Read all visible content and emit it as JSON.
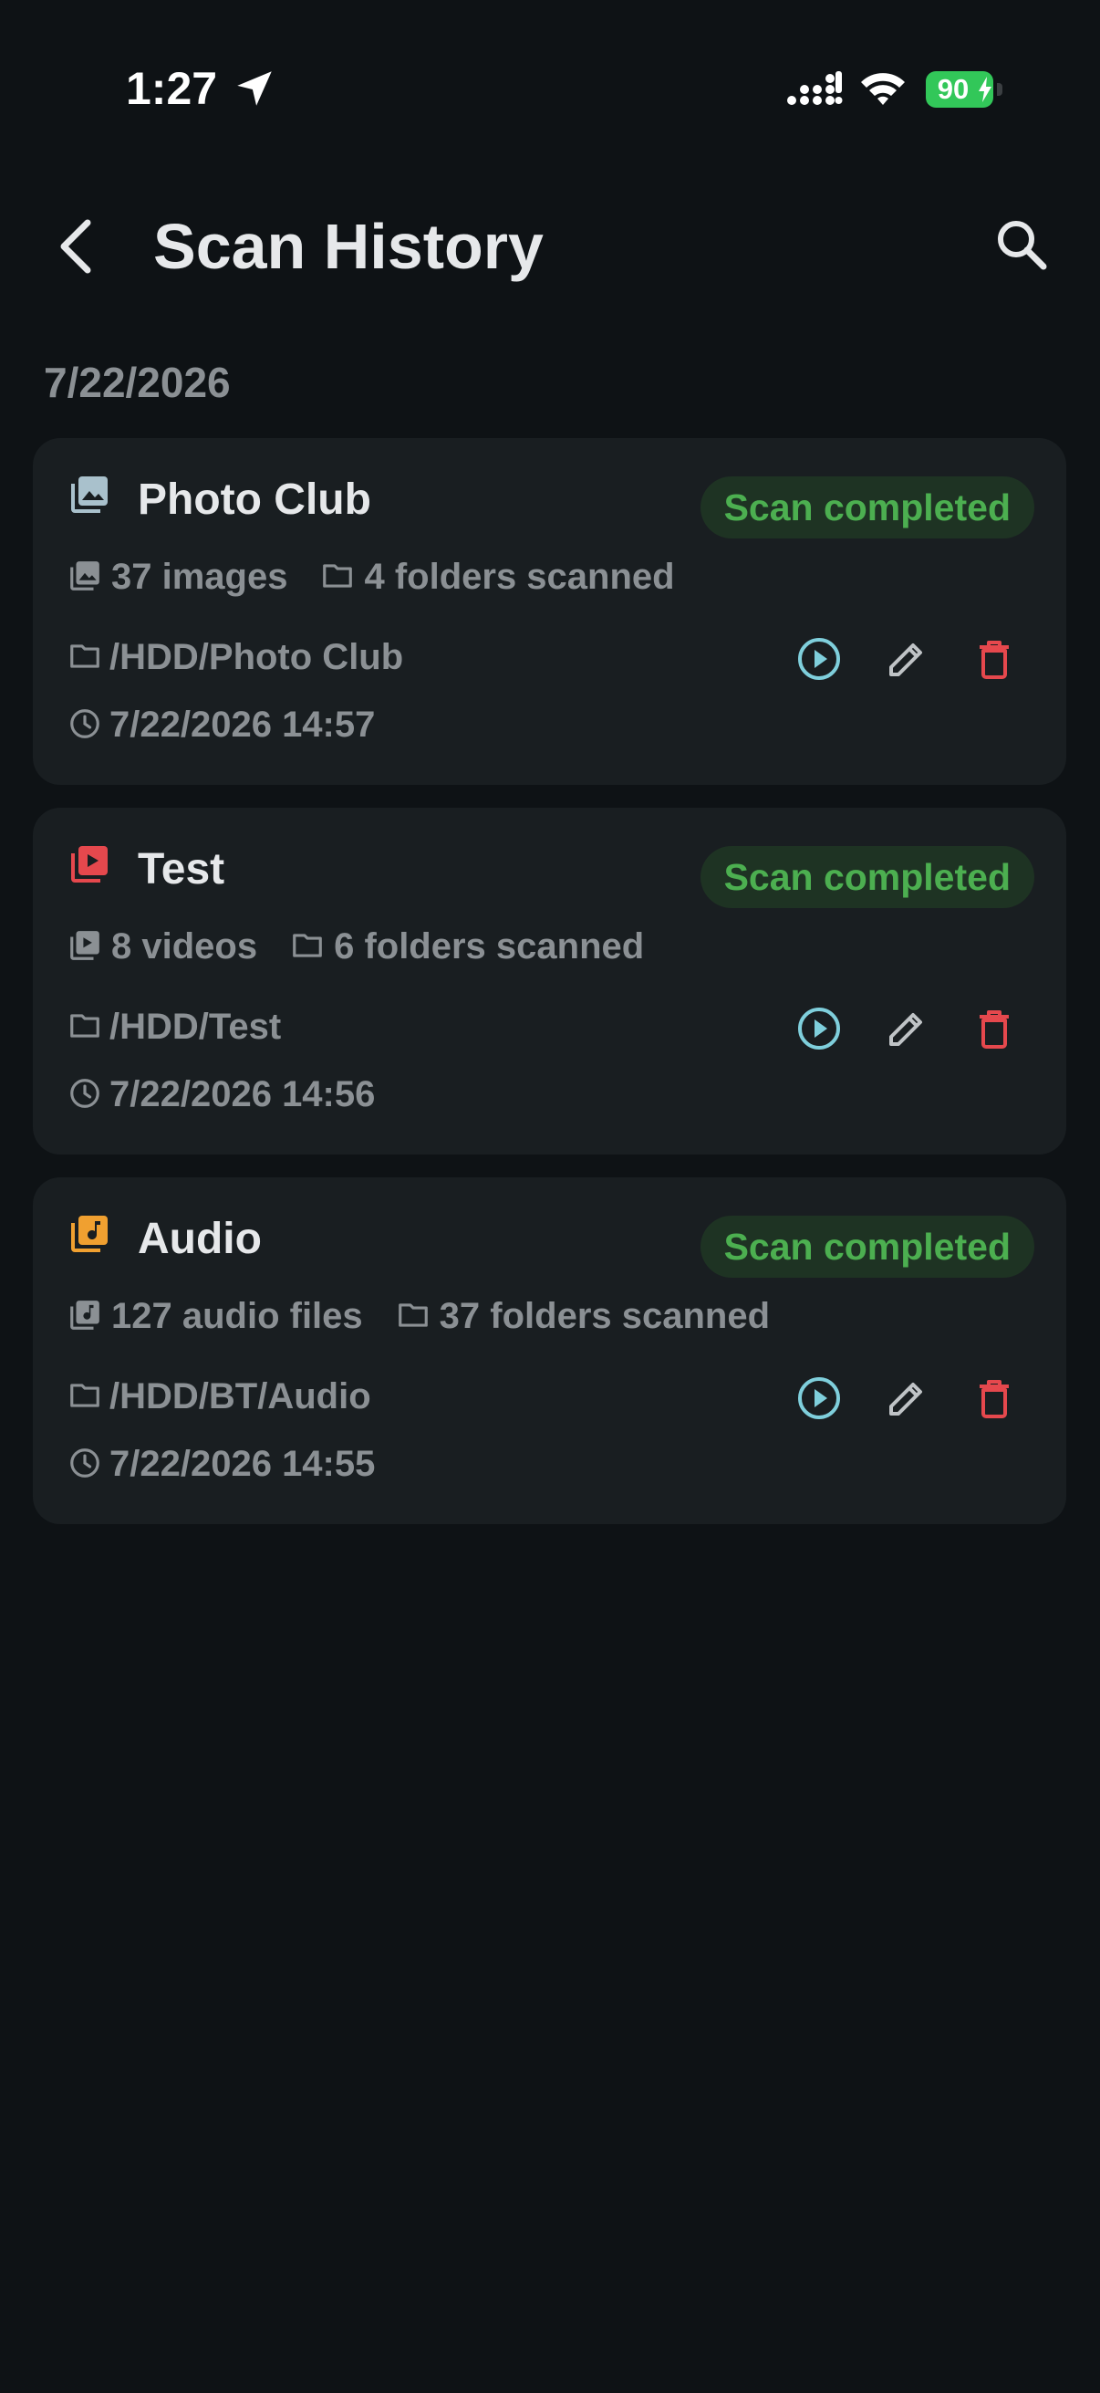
{
  "status_bar": {
    "time": "1:27",
    "battery": "90"
  },
  "header": {
    "title": "Scan History"
  },
  "date_heading": "7/22/2026",
  "colors": {
    "background": "#0e1215",
    "card": "#191e21",
    "badge_bg": "#1e3323",
    "badge_text": "#4caf50",
    "play": "#7fcfdc",
    "delete": "#e5484d",
    "image_icon": "#a9c1cc",
    "video_icon": "#e5484d",
    "audio_icon": "#f0a030"
  },
  "scans": [
    {
      "title": "Photo Club",
      "type_icon": "image-library-icon",
      "status": "Scan completed",
      "count": "37 images",
      "folders": "4 folders scanned",
      "path": "/HDD/Photo Club",
      "timestamp": "7/22/2026 14:57"
    },
    {
      "title": "Test",
      "type_icon": "video-library-icon",
      "status": "Scan completed",
      "count": "8 videos",
      "folders": "6 folders scanned",
      "path": "/HDD/Test",
      "timestamp": "7/22/2026 14:56"
    },
    {
      "title": "Audio",
      "type_icon": "audio-library-icon",
      "status": "Scan completed",
      "count": "127 audio files",
      "folders": "37 folders scanned",
      "path": "/HDD/BT/Audio",
      "timestamp": "7/22/2026 14:55"
    }
  ]
}
